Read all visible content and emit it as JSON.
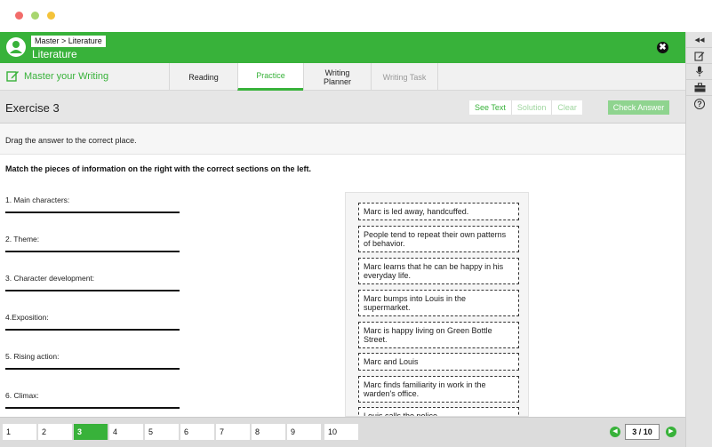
{
  "window": {
    "dot_colors": [
      "#f26c6a",
      "#a8d66f",
      "#f4c33a"
    ]
  },
  "header": {
    "breadcrumb": "Master > Literature",
    "title": "Literature",
    "close_glyph": "✖"
  },
  "nav": {
    "master_label": "Master your Writing",
    "tabs": [
      {
        "label": "Reading"
      },
      {
        "label": "Practice"
      },
      {
        "label": "Writing\nPlanner"
      },
      {
        "label": "Writing Task"
      }
    ]
  },
  "exercise": {
    "title": "Exercise 3",
    "see_text": "See Text",
    "solution": "Solution",
    "clear": "Clear",
    "check_answer": "Check Answer"
  },
  "instruction": "Drag the answer to the correct place.",
  "question": "Match the pieces of information on the right with the correct sections on the left.",
  "slots": [
    "1. Main characters:",
    "2. Theme:",
    "3. Character development:",
    "4.Exposition:",
    "5. Rising action:",
    "6. Climax:"
  ],
  "cards": [
    "Marc is led away, handcuffed.",
    "People tend to repeat their own patterns of behavior.",
    "Marc learns that he can be happy in his everyday life.",
    "Marc bumps into Louis in the supermarket.",
    "Marc is happy living on Green Bottle Street.",
    "Marc and Louis",
    "Marc finds familiarity in work in the warden's office.",
    "Louis calls the police."
  ],
  "pager": {
    "pages": [
      "1",
      "2",
      "3",
      "4",
      "5",
      "6",
      "7",
      "8",
      "9",
      "10"
    ],
    "current": "3 / 10",
    "prev_glyph": "◀",
    "next_glyph": "▶"
  },
  "sidebar_tools": [
    {
      "icon": "collapse-icon",
      "glyph": "◂◂"
    },
    {
      "icon": "notes-edit-icon"
    },
    {
      "icon": "microphone-icon"
    },
    {
      "icon": "briefcase-icon"
    },
    {
      "icon": "help-icon",
      "glyph": "?"
    }
  ],
  "colors": {
    "brand_green": "#38b23a",
    "light_green": "#8fd48f"
  }
}
